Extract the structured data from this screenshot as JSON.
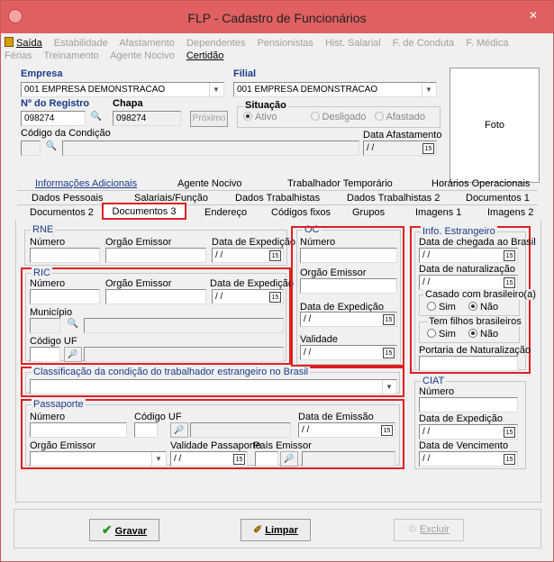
{
  "window": {
    "title": "FLP - Cadastro de Funcionários"
  },
  "menu_row1": [
    "Saída",
    "Estabilidade",
    "Afastamento",
    "Dependentes",
    "Pensionistas",
    "Hist. Salarial",
    "F. de Conduta",
    "F. Médica"
  ],
  "menu_row2": [
    "Férias",
    "Treinamento",
    "Agente Nocivo",
    "Certidão"
  ],
  "empresa": {
    "label": "Empresa",
    "value": "001 EMPRESA DEMONSTRACAO"
  },
  "filial": {
    "label": "Filial",
    "value": "001 EMPRESA DEMONSTRACAO"
  },
  "registro": {
    "label": "Nº do Registro",
    "value": "098274"
  },
  "chapa": {
    "label": "Chapa",
    "value": "098274"
  },
  "proximo_label": "Próximo",
  "situacao": {
    "label": "Situação",
    "options": [
      "Ativo",
      "Desligado",
      "Afastado"
    ]
  },
  "codigo_condicao": {
    "label": "Código da Condição"
  },
  "data_afastamento": {
    "label": "Data Afastamento",
    "value": "/ /"
  },
  "foto_label": "Foto",
  "tabs": {
    "row1": [
      "Informações Adicionais",
      "Agente Nocivo",
      "Trabalhador Temporário",
      "Horários Operacionais"
    ],
    "row2": [
      "Dados Pessoais",
      "Salariais/Função",
      "Dados Trabalhistas",
      "Dados Trabalhistas 2",
      "Documentos 1"
    ],
    "row3": [
      "Documentos 2",
      "Documentos 3",
      "Endereço",
      "Códigos fixos",
      "Grupos",
      "Imagens 1",
      "Imagens 2"
    ]
  },
  "rne": {
    "title": "RNE",
    "numero": "Número",
    "orgao": "Orgão Emissor",
    "data": "Data de Expedição",
    "date_value": "/ /"
  },
  "ric": {
    "title": "RIC",
    "numero": "Número",
    "orgao": "Orgão Emissor",
    "data": "Data de Expedição",
    "date_value": "/ /",
    "municipio": "Município",
    "codigo_uf": "Código UF"
  },
  "oc": {
    "title": "OC",
    "numero": "Número",
    "orgao": "Orgão Emissor",
    "data": "Data de Expedição",
    "validade": "Validade",
    "date_value": "/ /"
  },
  "estrangeiro": {
    "title": "Info. Estrangeiro",
    "chegada": "Data de chegada ao Brasil",
    "naturalizacao": "Data de naturalização",
    "casado": "Casado com brasileiro(a)",
    "filhos": "Tem filhos brasileiros",
    "sim": "Sim",
    "nao": "Não",
    "portaria": "Portaria de Naturalização",
    "date_value": "/ /"
  },
  "classificacao": {
    "label": "Classificação da condição do trabalhador estrangeiro no Brasil"
  },
  "passaporte": {
    "title": "Passaporte",
    "numero": "Número",
    "codigo_uf": "Código UF",
    "data_emissao": "Data de Emissão",
    "orgao": "Orgão Emissor",
    "validade": "Validade Passaporte",
    "pais": "País Emissor",
    "date_value": "/ /"
  },
  "ciat": {
    "title": "CIAT",
    "numero": "Número",
    "data_exp": "Data de Expedição",
    "data_venc": "Data de Vencimento",
    "date_value": "/ /"
  },
  "buttons": {
    "gravar": "Gravar",
    "limpar": "Limpar",
    "excluir": "Excluir"
  },
  "colors": {
    "titlebar": "#e06060",
    "highlight": "#e02020",
    "label_blue": "#1a3a8a"
  }
}
